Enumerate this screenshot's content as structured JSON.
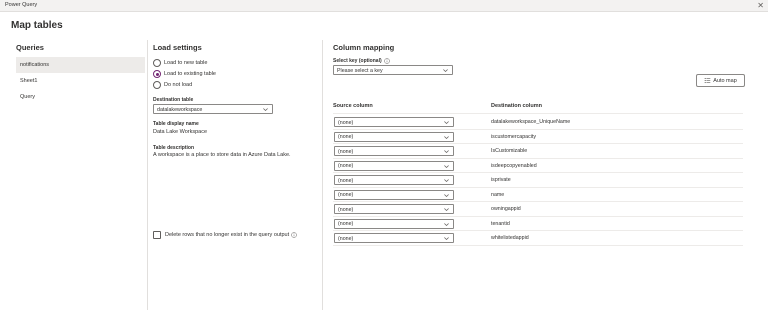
{
  "window": {
    "title": "Power Query",
    "close_glyph": "✕"
  },
  "page_title": "Map tables",
  "queries": {
    "heading": "Queries",
    "items": [
      {
        "label": "notifications",
        "selected": true
      },
      {
        "label": "Sheet1",
        "selected": false
      },
      {
        "label": "Query",
        "selected": false
      }
    ]
  },
  "load_settings": {
    "heading": "Load settings",
    "options": [
      {
        "label": "Load to new table",
        "checked": false
      },
      {
        "label": "Load to existing table",
        "checked": true
      },
      {
        "label": "Do not load",
        "checked": false
      }
    ],
    "destination_table_label": "Destination table",
    "destination_table_value": "datalakeworkspace",
    "display_name_label": "Table display name",
    "display_name_value": "Data Lake Workspace",
    "description_label": "Table description",
    "description_value": "A workspace is a place to store data in Azure Data Lake.",
    "delete_rows_label": "Delete rows that no longer exist in the query output",
    "delete_rows_checked": false
  },
  "column_mapping": {
    "heading": "Column mapping",
    "select_key_label": "Select key (optional)",
    "select_key_placeholder": "Please select a key",
    "auto_map_label": "Auto map",
    "source_column_header": "Source column",
    "destination_column_header": "Destination column",
    "rows": [
      {
        "source": "(none)",
        "destination": "datalakeworkspace_UniqueName"
      },
      {
        "source": "(none)",
        "destination": "iscustomercapacity"
      },
      {
        "source": "(none)",
        "destination": "IsCustomizable"
      },
      {
        "source": "(none)",
        "destination": "isdeepcopyenabled"
      },
      {
        "source": "(none)",
        "destination": "isprivate"
      },
      {
        "source": "(none)",
        "destination": "name"
      },
      {
        "source": "(none)",
        "destination": "owningappid"
      },
      {
        "source": "(none)",
        "destination": "tenantid"
      },
      {
        "source": "(none)",
        "destination": "whitelistedappid"
      }
    ]
  },
  "colors": {
    "accent": "#742774",
    "border": "#8a8886",
    "divider": "#e1dfdd",
    "selected_bg": "#edebe9"
  }
}
